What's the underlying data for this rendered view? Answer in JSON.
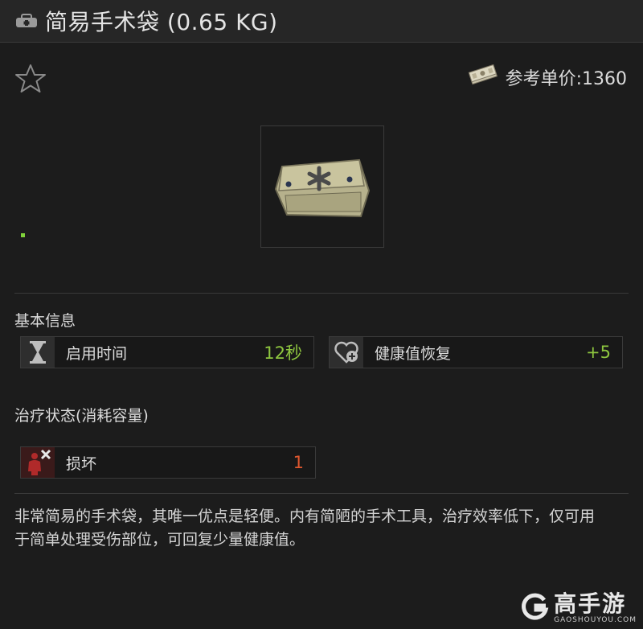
{
  "header": {
    "title": "简易手术袋 (0.65 KG)",
    "icon": "medkit-icon"
  },
  "favorite": {
    "icon": "star-outline-icon"
  },
  "price": {
    "label": "参考单价:1360",
    "icon": "money-bundle-icon"
  },
  "item_image": {
    "icon": "surgical-kit-icon"
  },
  "basic_info": {
    "title": "基本信息",
    "stats": [
      {
        "label": "启用时间",
        "value": "12秒",
        "icon": "hourglass-icon",
        "color": "#8ec63f"
      },
      {
        "label": "健康值恢复",
        "value": "+5",
        "icon": "heart-plus-icon",
        "color": "#8ec63f"
      }
    ]
  },
  "treatment": {
    "title": "治疗状态(消耗容量)",
    "stats": [
      {
        "label": "损坏",
        "value": "1",
        "icon": "broken-body-icon",
        "color": "#e0582f"
      }
    ]
  },
  "description": "非常简易的手术袋，其唯一优点是轻便。内有简陋的手术工具，治疗效率低下，仅可用于简单处理受伤部位，可回复少量健康值。",
  "watermark": {
    "logo": "gaoshou-logo-icon",
    "text_cn": "高手游",
    "text_en": "GAOSHOUYOU.COM"
  }
}
